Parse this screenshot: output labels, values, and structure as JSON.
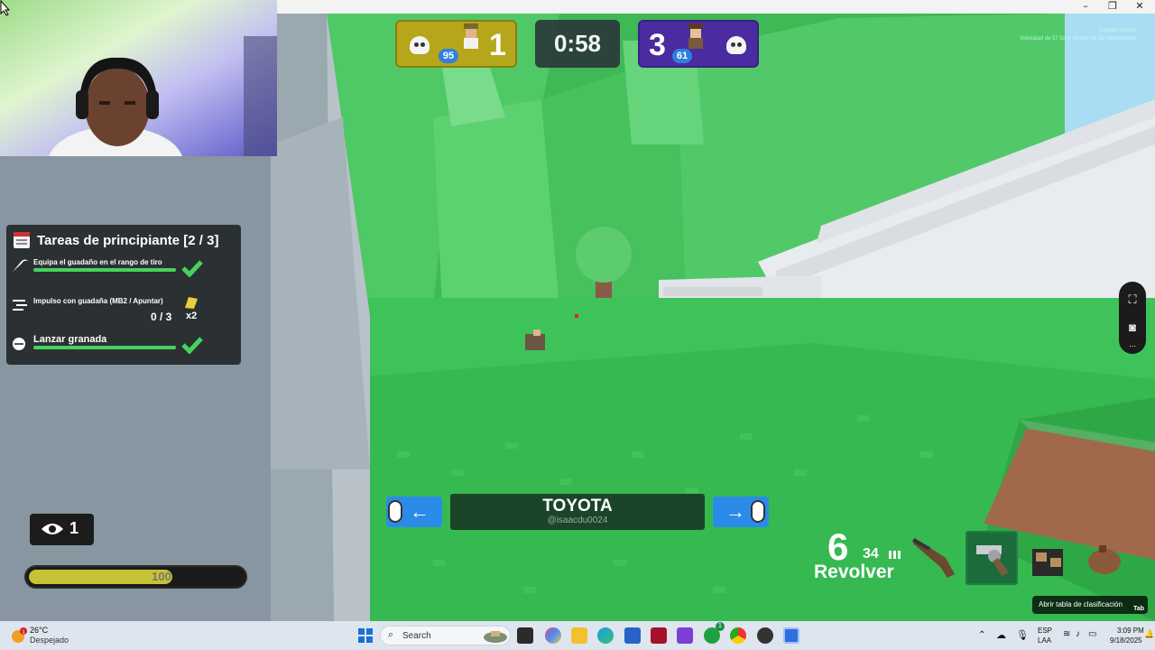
{
  "window": {
    "minimize": "–",
    "maximize": "❐",
    "close": "✕"
  },
  "top_info": {
    "region": "Estados Unidos",
    "perf": "Velocidad de 57 fps y tiempo de 29 milisegundos"
  },
  "scoreboard": {
    "left_score": "1",
    "left_hp": "95",
    "timer": "0:58",
    "right_score": "3",
    "right_hp": "61",
    "left_color": "#b6a61a",
    "right_color": "#4a2ba0"
  },
  "quests": {
    "title": "Tareas de principiante [2 / 3]",
    "items": [
      {
        "label": "Equipa el guadaño en el rango de tiro",
        "done": true,
        "icon": "scythe-icon"
      },
      {
        "label": "Impulso con guadaña (MB2 / Apuntar)",
        "done": false,
        "progress": "0 / 3",
        "multiplier": "x2",
        "icon": "dash-icon"
      },
      {
        "label": "Lanzar granada",
        "done": true,
        "icon": "grenade-icon"
      }
    ]
  },
  "spectators": {
    "count": "1"
  },
  "health": {
    "value": "100",
    "fraction": 0.67
  },
  "spectate": {
    "player_name": "TOYOTA",
    "username": "@isaacdu0024",
    "prev": "←",
    "next": "→"
  },
  "weapon": {
    "ammo": "6",
    "reserve": "34",
    "name": "Revolver"
  },
  "leaderboard_tip": {
    "label": "Abrir tabla de clasificación",
    "key": "Tab"
  },
  "taskbar": {
    "temp": "26°C",
    "weather": "Despejado",
    "search_placeholder": "Search",
    "lang1": "ESP",
    "lang2": "LAA",
    "time": "3:09 PM",
    "date": "9/18/2025",
    "weather_badge": "1",
    "xbox_badge": "1"
  }
}
